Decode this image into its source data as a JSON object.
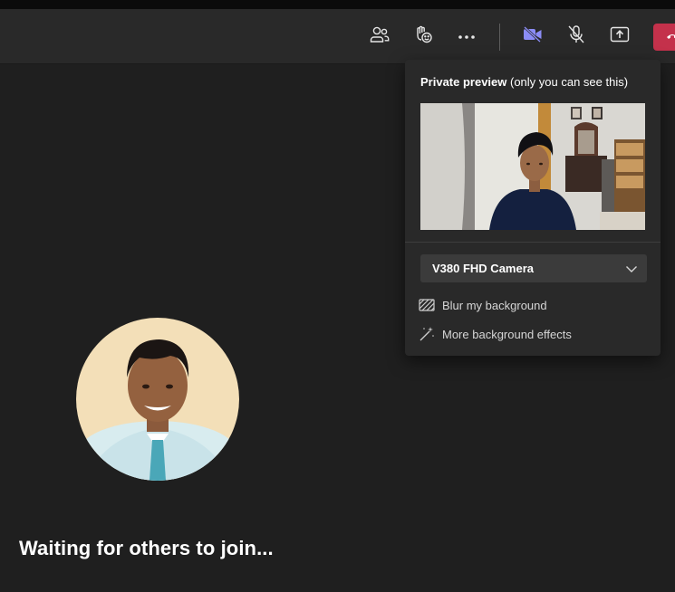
{
  "toolbar": {
    "buttons": [
      {
        "name": "people-icon"
      },
      {
        "name": "reactions-icon"
      },
      {
        "name": "more-options-icon"
      },
      {
        "name": "camera-icon",
        "color": "#8b8cf5"
      },
      {
        "name": "mic-off-icon"
      },
      {
        "name": "share-screen-icon"
      },
      {
        "name": "leave-call-icon",
        "color": "#c4314b"
      }
    ]
  },
  "preview_popup": {
    "title_bold": "Private preview",
    "title_rest": " (only you can see this)",
    "camera_select": {
      "selected": "V380 FHD Camera"
    },
    "menu": [
      {
        "label": "Blur my background",
        "icon": "blur-icon"
      },
      {
        "label": "More background effects",
        "icon": "magic-wand-icon"
      }
    ]
  },
  "main": {
    "waiting_text": "Waiting for others to join..."
  },
  "colors": {
    "background": "#1f1f1f",
    "toolbar": "#292929",
    "popup": "#292929",
    "accent": "#8b8cf5",
    "leave": "#c4314b"
  }
}
